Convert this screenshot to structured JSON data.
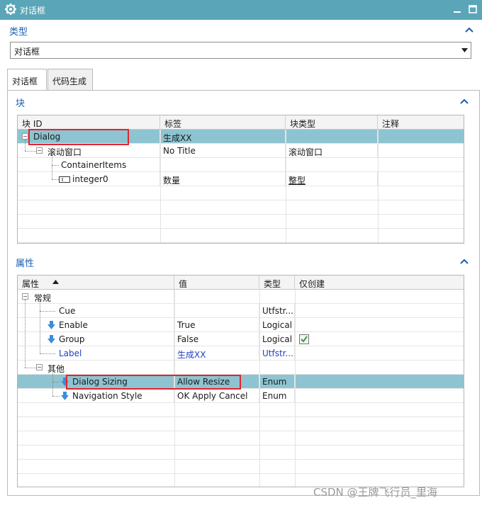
{
  "window": {
    "title": "对话框"
  },
  "type_section": {
    "title": "类型",
    "selected": "对话框"
  },
  "tabs": [
    "对话框",
    "代码生成"
  ],
  "block_section": {
    "title": "块",
    "columns": [
      "块 ID",
      "标签",
      "块类型",
      "注释"
    ],
    "rows": [
      {
        "id": "Dialog",
        "label": "生成XX",
        "type": "",
        "note": ""
      },
      {
        "id": "滚动窗口",
        "label": "No Title",
        "type": "滚动窗口",
        "note": ""
      },
      {
        "id": "ContainerItems",
        "label": "",
        "type": "",
        "note": ""
      },
      {
        "id": "integer0",
        "label": "数量",
        "type": "整型",
        "note": ""
      }
    ]
  },
  "prop_section": {
    "title": "属性",
    "columns": [
      "属性",
      "值",
      "类型",
      "仅创建"
    ],
    "groups": [
      "常规",
      "其他"
    ],
    "rows": [
      {
        "name": "Cue",
        "value": "",
        "type": "Utfstr..."
      },
      {
        "name": "Enable",
        "value": "True",
        "type": "Logical"
      },
      {
        "name": "Group",
        "value": "False",
        "type": "Logical"
      },
      {
        "name": "Label",
        "value": "生成XX",
        "type": "Utfstr..."
      },
      {
        "name": "Dialog Sizing",
        "value": "Allow Resize",
        "type": "Enum"
      },
      {
        "name": "Navigation Style",
        "value": "OK Apply Cancel",
        "type": "Enum"
      }
    ]
  },
  "watermark": "CSDN @王牌飞行员_里海",
  "colors": {
    "titlebar": "#5aa6b8",
    "section_title": "#1a5fb4",
    "selection": "#8ec4d1",
    "highlight_box": "#e2242e"
  }
}
